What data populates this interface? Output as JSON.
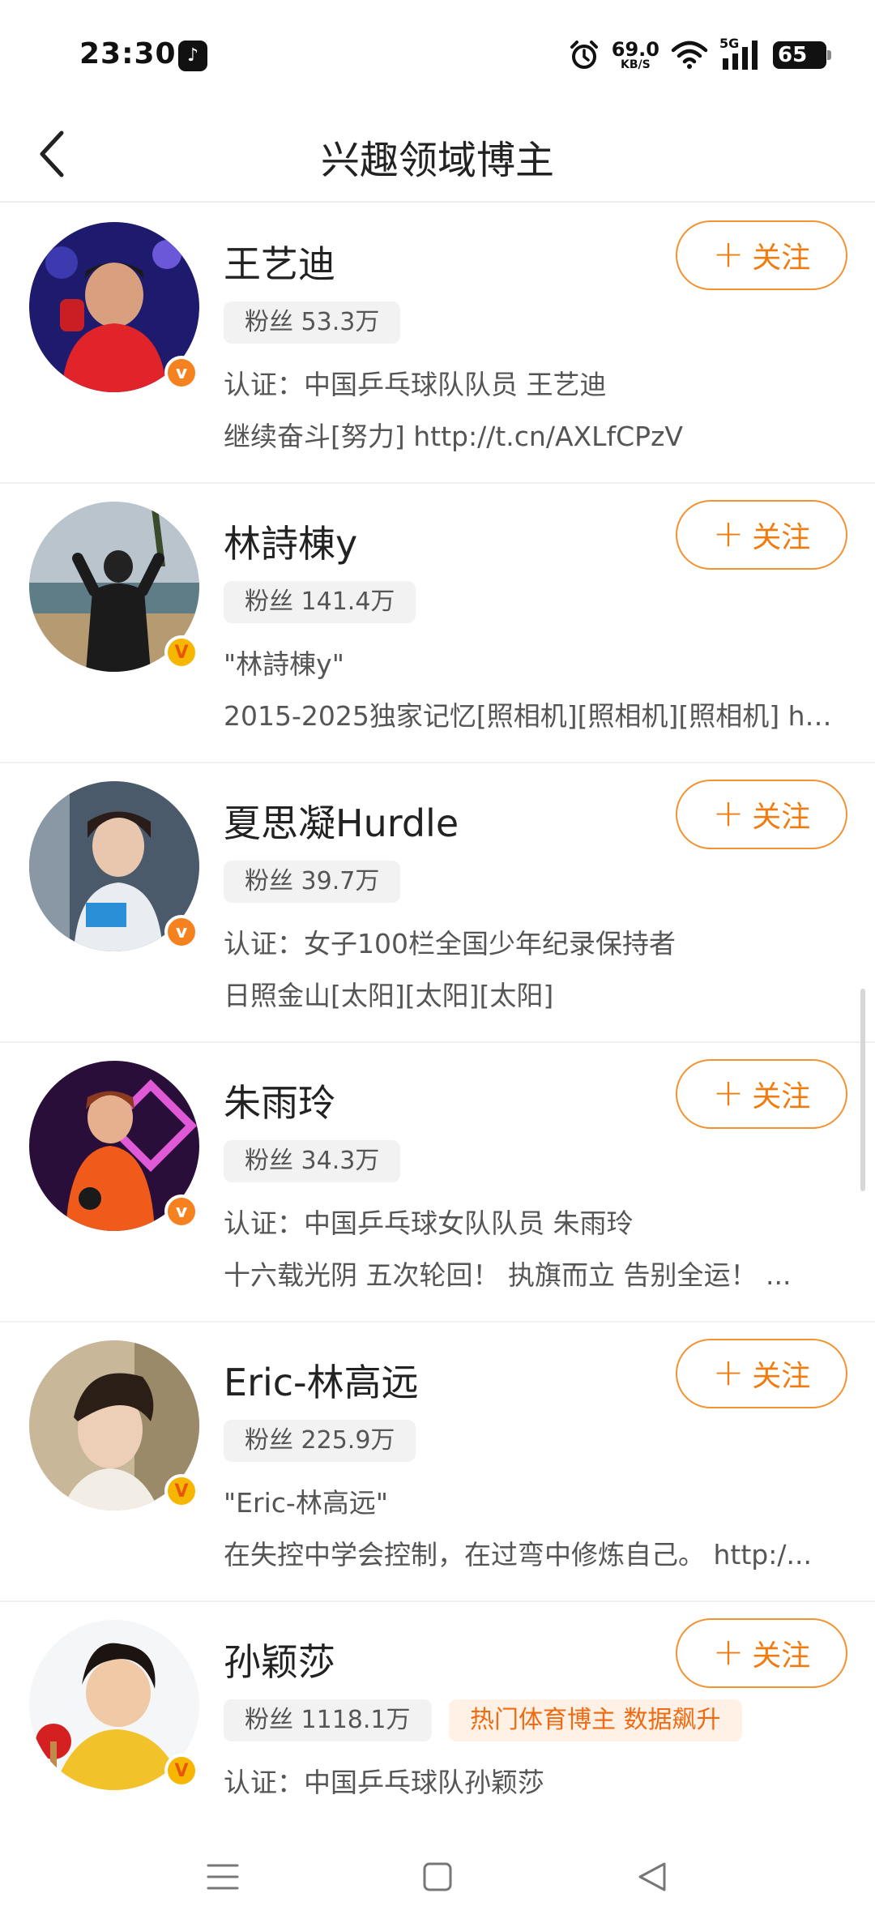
{
  "status_bar": {
    "time": "23:30",
    "app_icon": "tiktok-icon",
    "net_speed_value": "69.0",
    "net_speed_unit": "KB/S",
    "network": "5G",
    "battery": "65"
  },
  "header": {
    "title": "兴趣领域博主"
  },
  "colors": {
    "accent": "#f07c10",
    "follow_border": "#f39230",
    "badge_orange": "#f5821f",
    "badge_gold": "#f7b600",
    "fans_bg": "#f2f2f2",
    "hot_tag_bg": "#fff1e6"
  },
  "bloggers": [
    {
      "name": "王艺迪",
      "fans": "粉丝 53.3万",
      "line1": "认证：中国乒乓球队队员 王艺迪",
      "line2": "继续奋斗[努力] http://t.cn/AXLfCPzV",
      "follow": "关注",
      "badge": "orange-v-badge"
    },
    {
      "name": "林詩棟y",
      "fans": "粉丝 141.4万",
      "line1": "\"林詩棟y\"",
      "line2": "2015-2025独家记忆[照相机][照相机][照相机] ht...",
      "follow": "关注",
      "badge": "gold-v-badge"
    },
    {
      "name": "夏思凝Hurdle",
      "fans": "粉丝 39.7万",
      "line1": "认证：女子100栏全国少年纪录保持者",
      "line2": "日照金山[太阳][太阳][太阳]",
      "follow": "关注",
      "badge": "orange-v-badge"
    },
    {
      "name": "朱雨玲",
      "fans": "粉丝 34.3万",
      "line1": "认证：中国乒乓球女队队员 朱雨玲",
      "line2": "十六载光阴 五次轮回！ 执旗而立 告别全运！ ...",
      "follow": "关注",
      "badge": "orange-v-badge"
    },
    {
      "name": "Eric-林高远",
      "fans": "粉丝 225.9万",
      "line1": "\"Eric-林高远\"",
      "line2": "在失控中学会控制，在过弯中修炼自己。 http:/...",
      "follow": "关注",
      "badge": "gold-v-badge"
    },
    {
      "name": "孙颖莎",
      "fans": "粉丝 1118.1万",
      "hot_tag": "热门体育博主 数据飙升",
      "line1": "认证：中国乒乓球队孙颖莎",
      "follow": "关注",
      "badge": "gold-v-badge"
    }
  ],
  "system_nav": {
    "menu": "menu-icon",
    "home": "home-square-icon",
    "back": "back-triangle-icon"
  }
}
